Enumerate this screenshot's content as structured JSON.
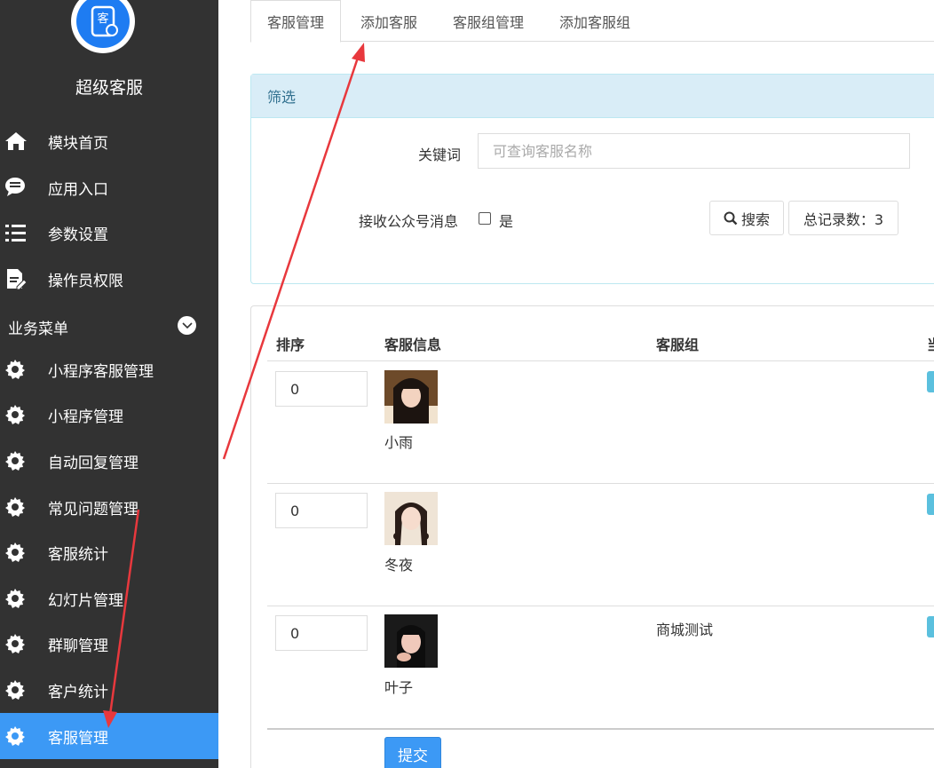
{
  "app": {
    "name": "超级客服",
    "logo_text": "客"
  },
  "sidebar": {
    "items": [
      {
        "label": "模块首页",
        "icon": "home-icon"
      },
      {
        "label": "应用入口",
        "icon": "chat-icon"
      },
      {
        "label": "参数设置",
        "icon": "list-settings-icon"
      },
      {
        "label": "操作员权限",
        "icon": "document-edit-icon"
      }
    ],
    "section_title": "业务菜单",
    "business_items": [
      {
        "label": "小程序客服管理",
        "icon": "gear-icon"
      },
      {
        "label": "小程序管理",
        "icon": "gear-icon"
      },
      {
        "label": "自动回复管理",
        "icon": "gear-icon"
      },
      {
        "label": "常见问题管理",
        "icon": "gear-icon"
      },
      {
        "label": "客服统计",
        "icon": "gear-icon"
      },
      {
        "label": "幻灯片管理",
        "icon": "gear-icon"
      },
      {
        "label": "群聊管理",
        "icon": "gear-icon"
      },
      {
        "label": "客户统计",
        "icon": "gear-icon"
      },
      {
        "label": "客服管理",
        "icon": "gear-icon",
        "active": true
      }
    ]
  },
  "tabs": [
    {
      "label": "客服管理",
      "active": true
    },
    {
      "label": "添加客服"
    },
    {
      "label": "客服组管理"
    },
    {
      "label": "添加客服组"
    }
  ],
  "filter": {
    "title": "筛选",
    "keyword_label": "关键词",
    "keyword_placeholder": "可查询客服名称",
    "keyword_value": "",
    "receive_label": "接收公众号消息",
    "receive_option": "是",
    "search_button": "搜索",
    "total_label": "总记录数：3"
  },
  "table": {
    "columns": [
      "排序",
      "客服信息",
      "客服组",
      "当"
    ],
    "rows": [
      {
        "sort": "0",
        "name": "小雨",
        "group": ""
      },
      {
        "sort": "0",
        "name": "冬夜",
        "group": ""
      },
      {
        "sort": "0",
        "name": "叶子",
        "group": "商城测试"
      }
    ],
    "submit_button": "提交"
  },
  "colors": {
    "sidebar_bg": "#323232",
    "accent": "#3c99f5",
    "panel_head": "#d9edf7",
    "annotation_arrow": "#e8383d"
  }
}
